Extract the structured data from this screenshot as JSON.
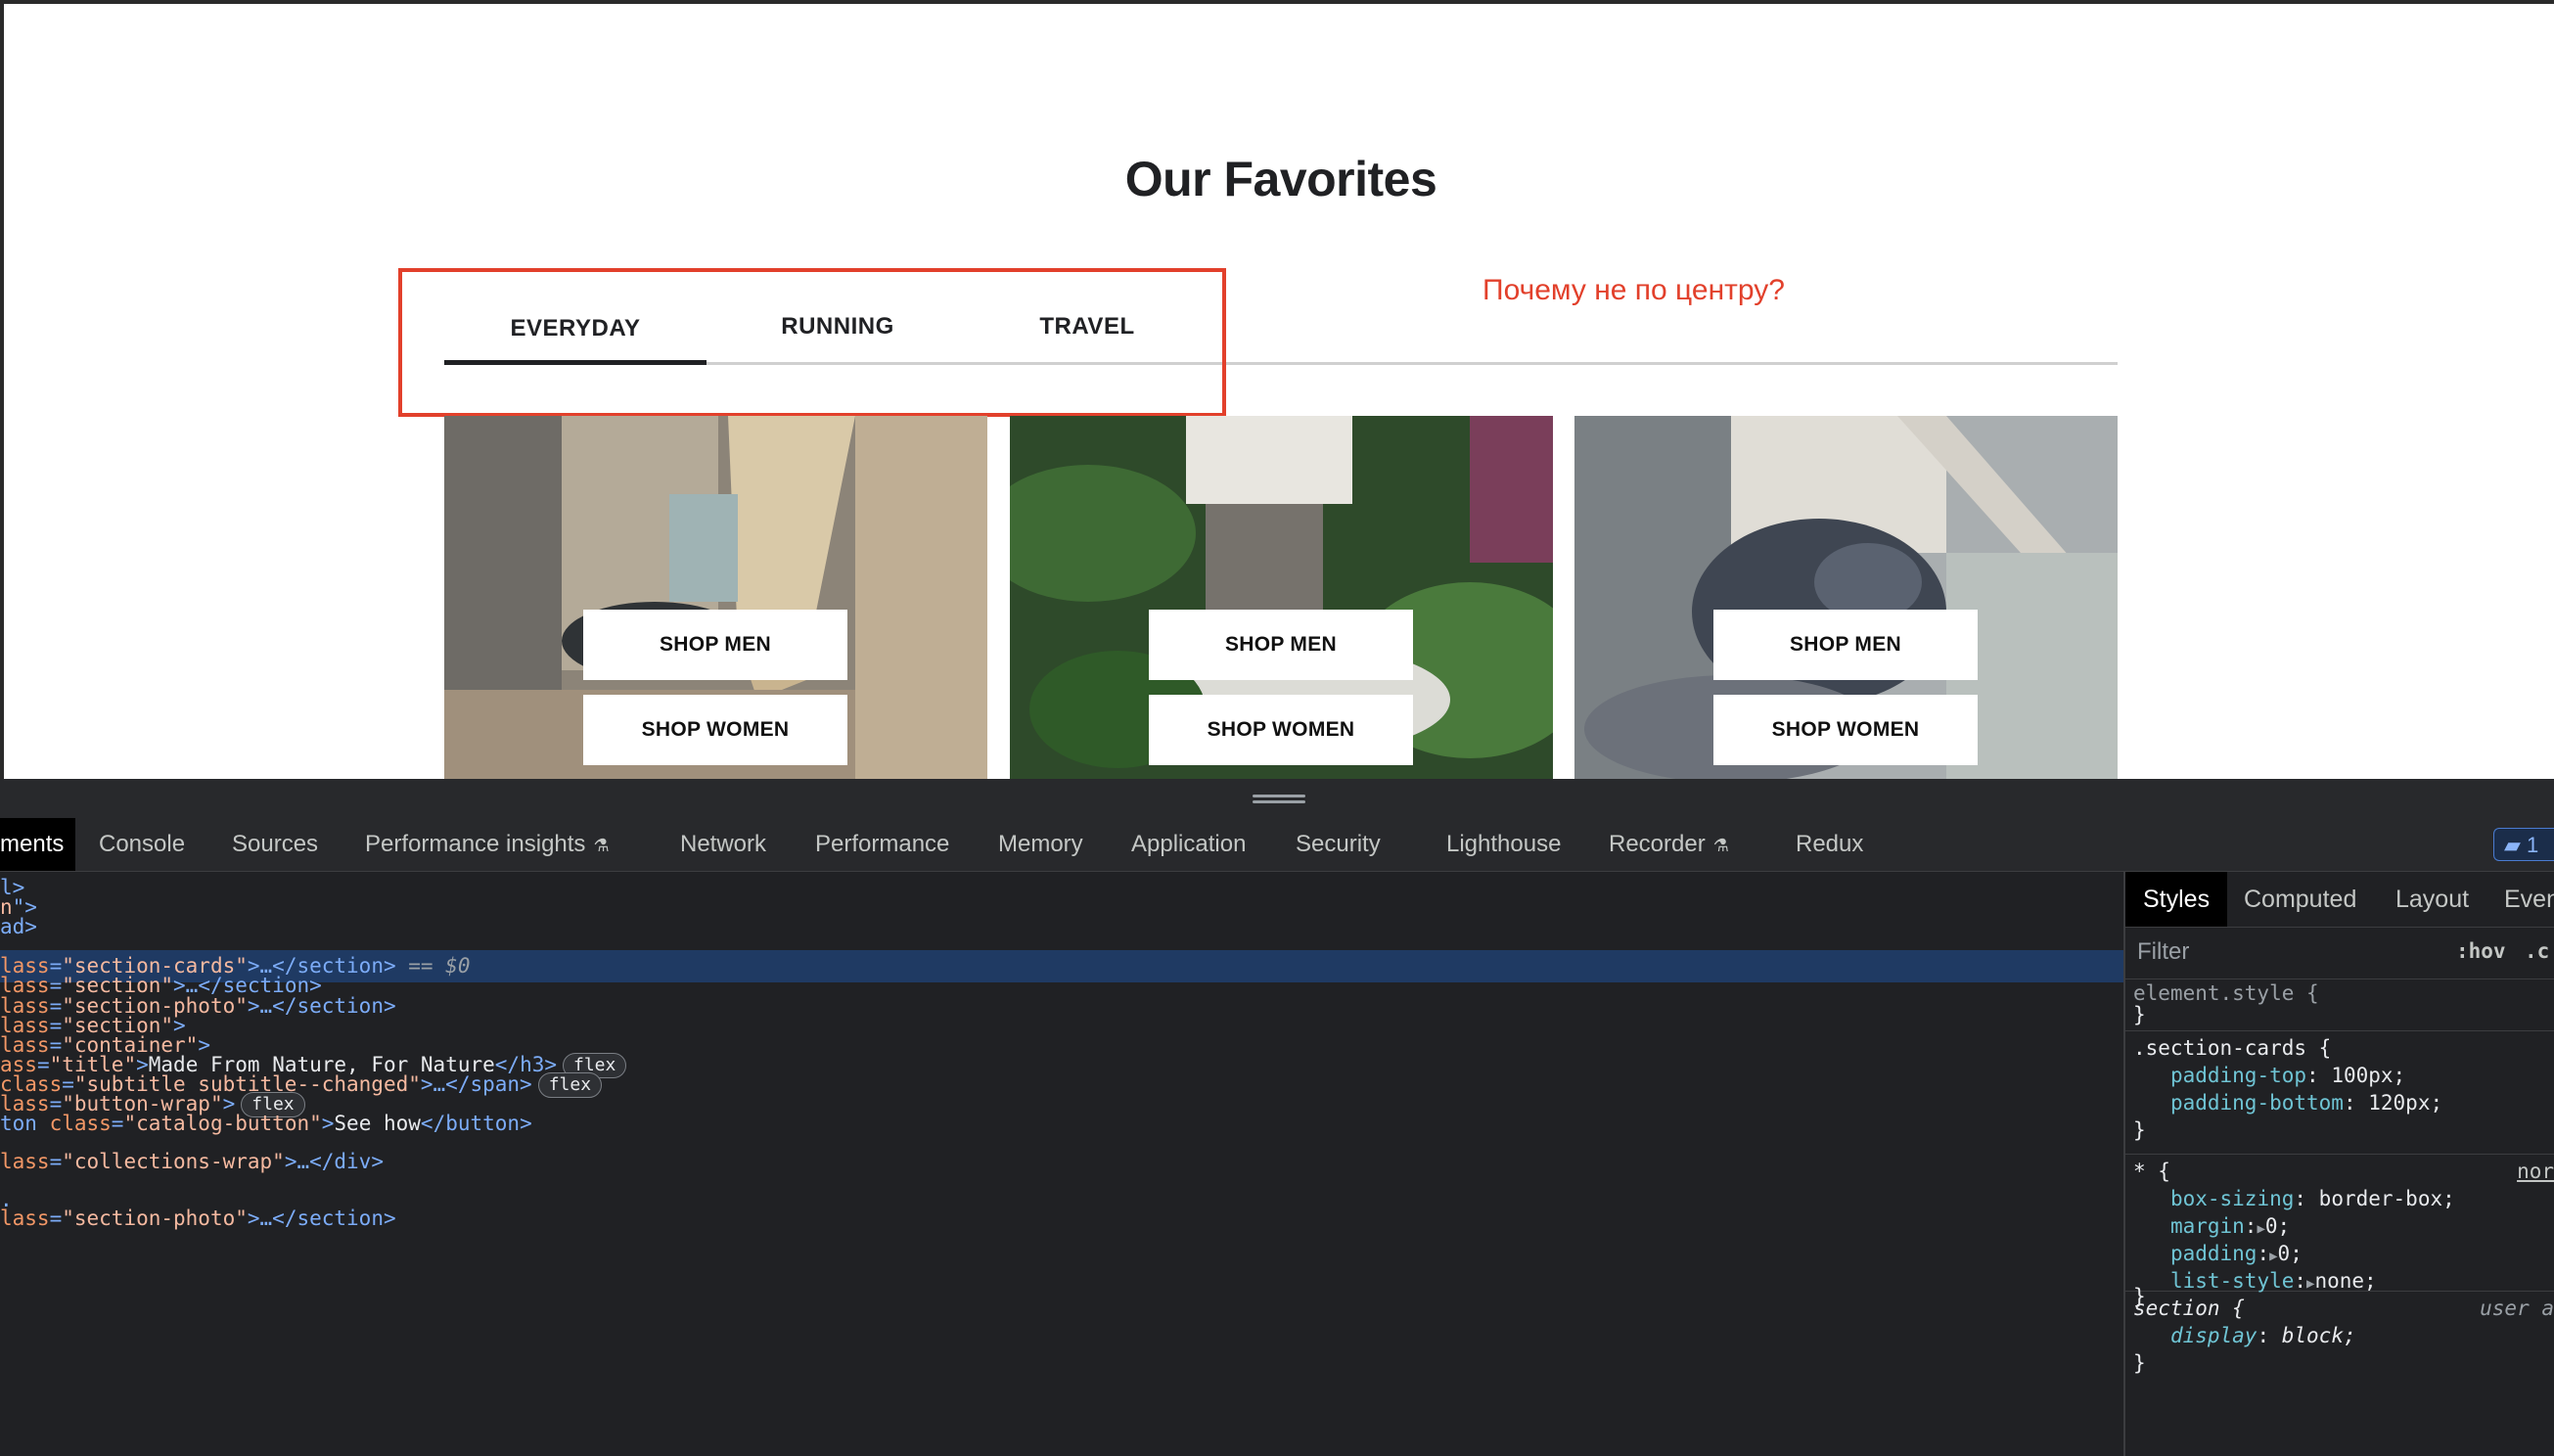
{
  "page": {
    "title": "Our Favorites",
    "tabs": [
      "EVERYDAY",
      "RUNNING",
      "TRAVEL"
    ],
    "annotation": "Почему не по центру?",
    "cards": [
      {
        "shop_men": "SHOP MEN",
        "shop_women": "SHOP WOMEN"
      },
      {
        "shop_men": "SHOP MEN",
        "shop_women": "SHOP WOMEN"
      },
      {
        "shop_men": "SHOP MEN",
        "shop_women": "SHOP WOMEN"
      }
    ],
    "colors": {
      "annotation": "#e2402b",
      "title": "#202124"
    }
  },
  "devtools": {
    "tabs": [
      "ments",
      "Console",
      "Sources",
      "Performance insights",
      "Network",
      "Performance",
      "Memory",
      "Application",
      "Security",
      "Lighthouse",
      "Recorder",
      "Redux"
    ],
    "issues_count": "1",
    "dom": {
      "l0": "l>",
      "l1a": "n",
      "l1b": "\">",
      "l2": "ad>",
      "l3": {
        "attr": "lass",
        "val": "\"section-cards\"",
        "tail": ">…</section>",
        "marker": " == $0"
      },
      "l4": {
        "attr": "lass",
        "val": "\"section\"",
        "tail": ">…</section>"
      },
      "l5": {
        "attr": "lass",
        "val": "\"section-photo\"",
        "tail": ">…</section>"
      },
      "l6": {
        "attr": "lass",
        "val": "\"section\"",
        "tail": ">"
      },
      "l7": {
        "attr": "lass",
        "val": "\"container\"",
        "tail": ">"
      },
      "l8": {
        "attr": "ass",
        "val": "\"title\"",
        "text": "Made From Nature, For Nature",
        "close": "</h3>",
        "badge": "flex"
      },
      "l9": {
        "attr": "class",
        "val": "\"subtitle subtitle--changed\"",
        "tail": ">…</span>",
        "badge": "flex"
      },
      "l10": {
        "attr": "lass",
        "val": "\"button-wrap\"",
        "tail": ">",
        "badge": "flex"
      },
      "l11": {
        "pre": "ton ",
        "attr": "class",
        "val": "\"catalog-button\"",
        "text": "See how",
        "close": "</button>"
      },
      "l12": "",
      "l13": {
        "attr": "lass",
        "val": "\"collections-wrap\"",
        "tail": ">…</div>"
      },
      "l14": "",
      "l15": ".",
      "l16": {
        "attr": "lass",
        "val": "\"section-photo\"",
        "tail": ">…</section>"
      }
    },
    "styles": {
      "tabs": [
        "Styles",
        "Computed",
        "Layout",
        "Even"
      ],
      "filter_placeholder": "Filter",
      "hov": ":hov",
      "cls": ".c",
      "rules": {
        "element_style": "element.style {",
        "close": "}",
        "section_cards": ".section-cards {",
        "padding_top_prop": "padding-top",
        "padding_top_val": "100px;",
        "padding_bottom_prop": "padding-bottom",
        "padding_bottom_val": "120px;",
        "universal": "* {",
        "universal_origin": "nor",
        "box_sizing_prop": "box-sizing",
        "box_sizing_val": "border-box;",
        "margin_prop": "margin",
        "margin_val": "0;",
        "padding_prop": "padding",
        "padding_val": "0;",
        "list_style_prop": "list-style",
        "list_style_val": "none;",
        "section_sel": "section {",
        "section_origin": "user a",
        "display_prop": "display",
        "display_val": "block;"
      }
    }
  }
}
